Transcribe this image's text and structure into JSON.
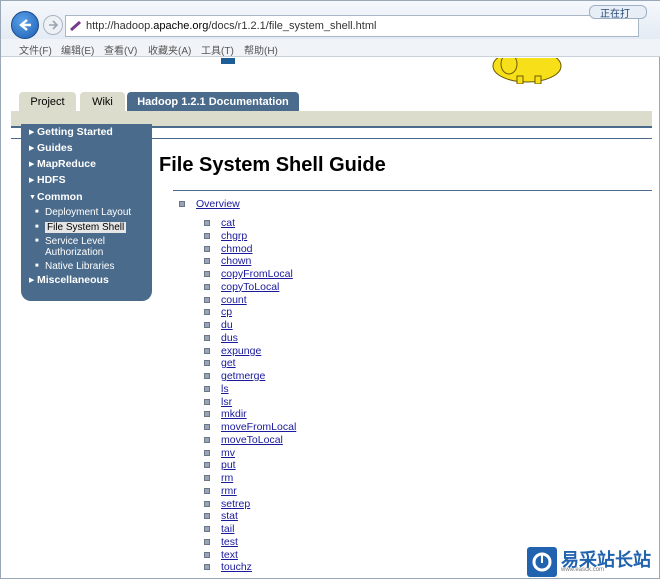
{
  "browser": {
    "url_prefix": "http://hadoop.",
    "url_host": "apache.org",
    "url_path": "/docs/r1.2.1/file_system_shell.html",
    "menubar": [
      "文件(F)",
      "编辑(E)",
      "查看(V)",
      "收藏夹(A)",
      "工具(T)",
      "帮助(H)"
    ],
    "tab_badge": "正在打"
  },
  "tabs": [
    {
      "label": "Project"
    },
    {
      "label": "Wiki"
    },
    {
      "label": "Hadoop 1.2.1 Documentation"
    }
  ],
  "sidebar": {
    "items": [
      {
        "label": "Getting Started"
      },
      {
        "label": "Guides"
      },
      {
        "label": "MapReduce"
      },
      {
        "label": "HDFS"
      },
      {
        "label": "Common"
      },
      {
        "label": "Miscellaneous"
      }
    ],
    "common_subitems": [
      {
        "label": "Deployment Layout"
      },
      {
        "label": "File System Shell"
      },
      {
        "label": "Service Level"
      },
      {
        "label": "Authorization"
      },
      {
        "label": "Native Libraries"
      }
    ]
  },
  "main": {
    "title": "File System Shell Guide",
    "overview": "Overview",
    "commands": [
      "cat",
      "chgrp",
      "chmod",
      "chown",
      "copyFromLocal",
      "copyToLocal",
      "count",
      "cp",
      "du",
      "dus",
      "expunge",
      "get",
      "getmerge",
      "ls",
      "lsr",
      "mkdir",
      "moveFromLocal",
      "moveToLocal",
      "mv",
      "put",
      "rm",
      "rmr",
      "setrep",
      "stat",
      "tail",
      "test",
      "text",
      "touchz"
    ]
  },
  "watermark": {
    "text": "易采站长站",
    "sub": "www.easck.com"
  },
  "colors": {
    "nav_blue": "#4a6b8c",
    "tab_beige": "#dcdccc",
    "link": "#1a1a9c"
  }
}
